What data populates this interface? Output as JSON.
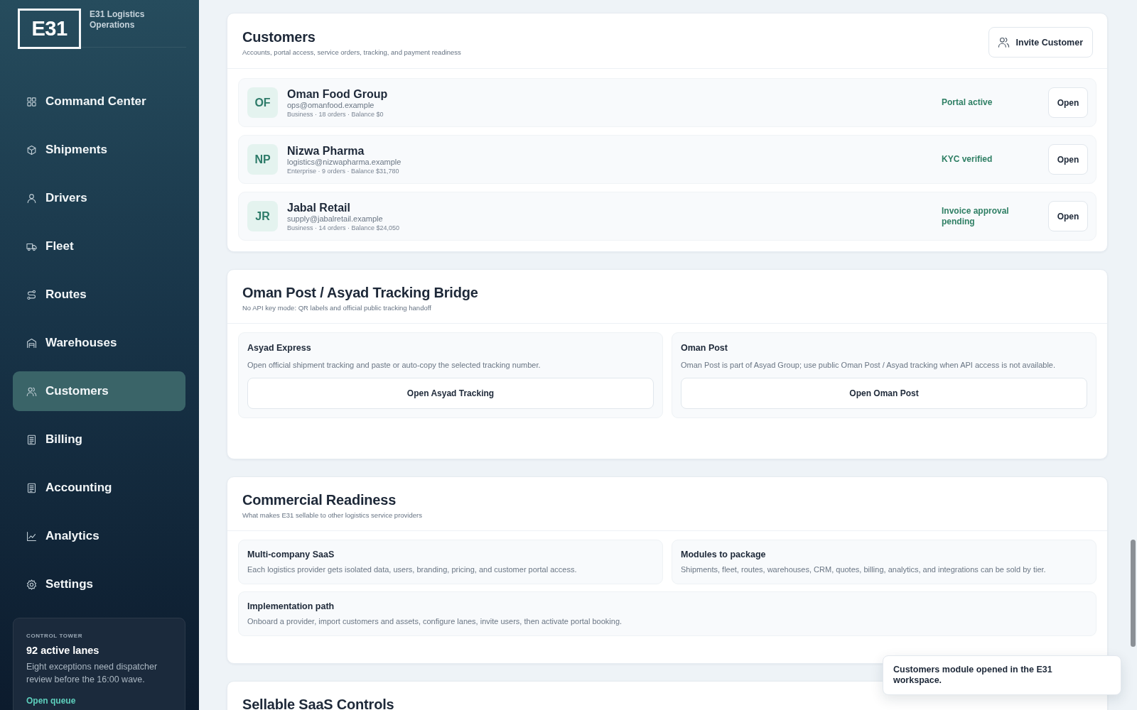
{
  "sidebar": {
    "logo": "E31",
    "brand": "E31 Logistics Operations",
    "nav": [
      {
        "label": "Command Center",
        "selected": false
      },
      {
        "label": "Shipments",
        "selected": false
      },
      {
        "label": "Drivers",
        "selected": false
      },
      {
        "label": "Fleet",
        "selected": false
      },
      {
        "label": "Routes",
        "selected": false
      },
      {
        "label": "Warehouses",
        "selected": false
      },
      {
        "label": "Customers",
        "selected": true
      },
      {
        "label": "Billing",
        "selected": false
      },
      {
        "label": "Accounting",
        "selected": false
      },
      {
        "label": "Analytics",
        "selected": false
      },
      {
        "label": "Settings",
        "selected": false
      }
    ],
    "control_tower": {
      "eyebrow": "CONTROL TOWER",
      "title": "92 active lanes",
      "description": "Eight exceptions need dispatcher review before the 16:00 wave.",
      "link": "Open queue"
    }
  },
  "customers": {
    "title": "Customers",
    "subtitle": "Accounts, portal access, service orders, tracking, and payment readiness",
    "invite_button": "Invite Customer",
    "rows": [
      {
        "initials": "OF",
        "name": "Oman Food Group",
        "email": "ops@omanfood.example",
        "meta": "Business · 18 orders · Balance $0",
        "status": "Portal active",
        "action": "Open"
      },
      {
        "initials": "NP",
        "name": "Nizwa Pharma",
        "email": "logistics@nizwapharma.example",
        "meta": "Enterprise · 9 orders · Balance $31,780",
        "status": "KYC verified",
        "action": "Open"
      },
      {
        "initials": "JR",
        "name": "Jabal Retail",
        "email": "supply@jabalretail.example",
        "meta": "Business · 14 orders · Balance $24,050",
        "status": "Invoice approval pending",
        "action": "Open"
      }
    ]
  },
  "tracking_bridge": {
    "title": "Oman Post / Asyad Tracking Bridge",
    "subtitle": "No API key mode: QR labels and official public tracking handoff",
    "carriers": [
      {
        "name": "Asyad Express",
        "description": "Open official shipment tracking and paste or auto-copy the selected tracking number.",
        "button": "Open Asyad Tracking"
      },
      {
        "name": "Oman Post",
        "description": "Oman Post is part of Asyad Group; use public Oman Post / Asyad tracking when API access is not available.",
        "button": "Open Oman Post"
      }
    ]
  },
  "commercial_readiness": {
    "title": "Commercial Readiness",
    "subtitle": "What makes E31 sellable to other logistics service providers",
    "items": [
      {
        "title": "Multi-company SaaS",
        "description": "Each logistics provider gets isolated data, users, branding, pricing, and customer portal access."
      },
      {
        "title": "Modules to package",
        "description": "Shipments, fleet, routes, warehouses, CRM, quotes, billing, analytics, and integrations can be sold by tier."
      },
      {
        "title": "Implementation path",
        "description": "Onboard a provider, import customers and assets, configure lanes, invite users, then activate portal booking."
      }
    ]
  },
  "next_section": {
    "title": "Sellable SaaS Controls"
  },
  "toast": {
    "message": "Customers module opened in the E31 workspace."
  }
}
